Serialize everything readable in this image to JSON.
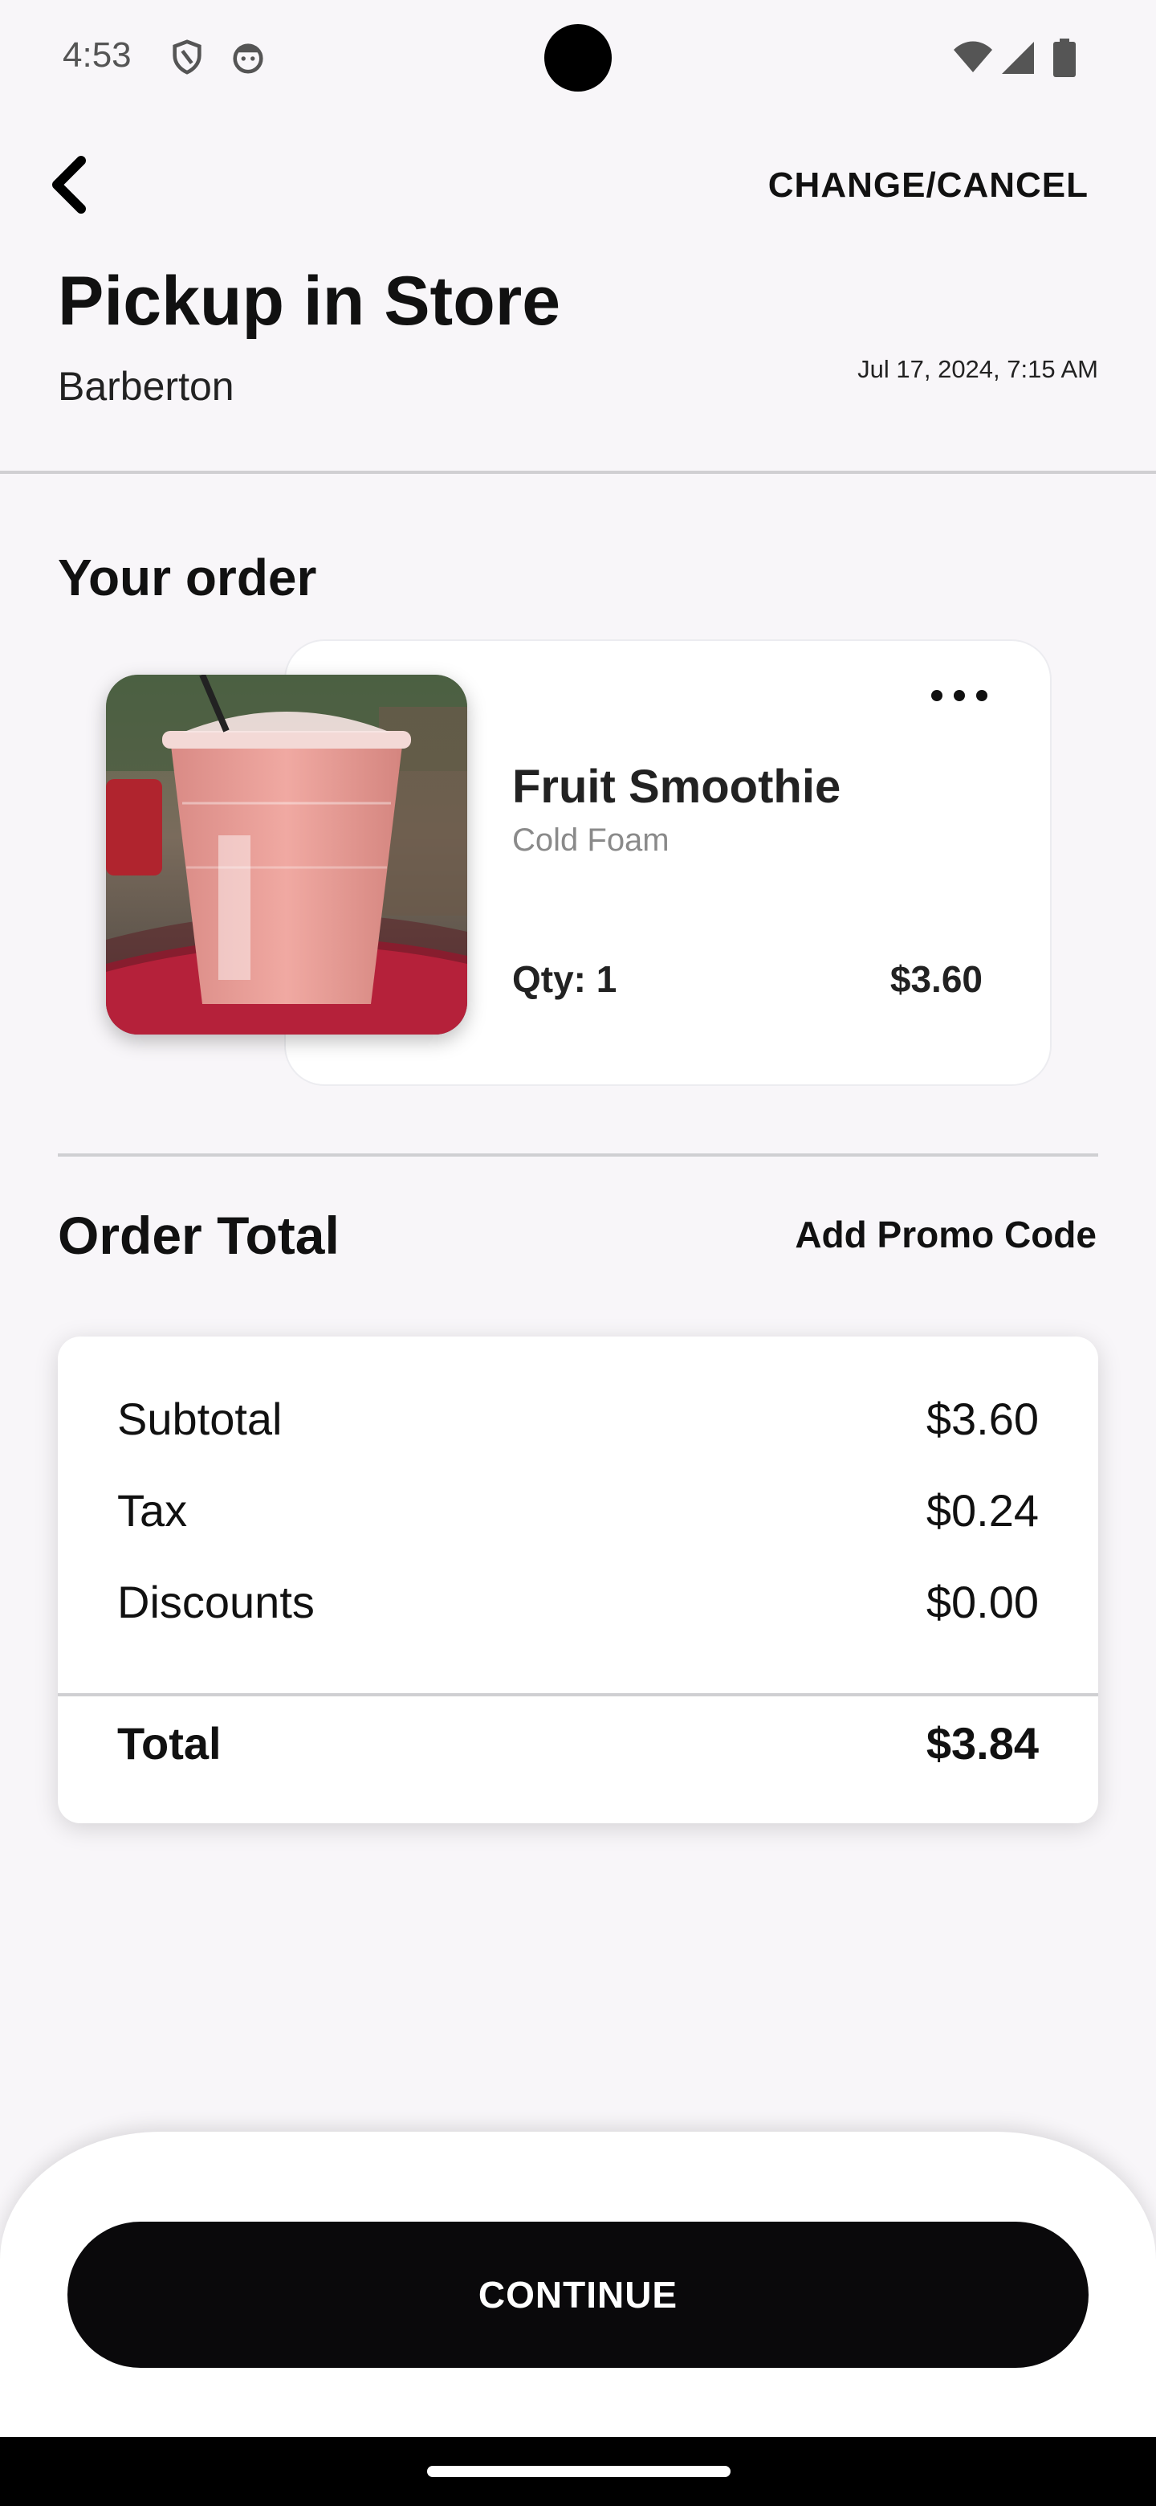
{
  "status_bar": {
    "time": "4:53",
    "icons": [
      "shield-icon",
      "face-icon",
      "wifi-icon",
      "signal-icon",
      "battery-icon"
    ]
  },
  "header": {
    "back_icon": "chevron-left-icon",
    "change_cancel_label": "CHANGE/CANCEL",
    "title": "Pickup in Store",
    "store_name": "Barberton",
    "pickup_time": "Jul 17, 2024, 7:15 AM"
  },
  "order": {
    "section_label": "Your order",
    "items": [
      {
        "name": "Fruit Smoothie",
        "modifier": "Cold Foam",
        "quantity": "Qty: 1",
        "price": "$3.60",
        "image": "fruit-smoothie-photo"
      }
    ]
  },
  "totals": {
    "section_label": "Order Total",
    "promo_label": "Add Promo Code",
    "subtotal_label": "Subtotal",
    "subtotal_value": "$3.60",
    "tax_label": "Tax",
    "tax_value": "$0.24",
    "discounts_label": "Discounts",
    "discounts_value": "$0.00",
    "total_label": "Total",
    "total_value": "$3.84"
  },
  "footer": {
    "continue_label": "CONTINUE"
  },
  "colors": {
    "background": "#f8f6f9",
    "card": "#ffffff",
    "primary_button": "#0a090b",
    "muted_text": "#8a8a8a"
  }
}
